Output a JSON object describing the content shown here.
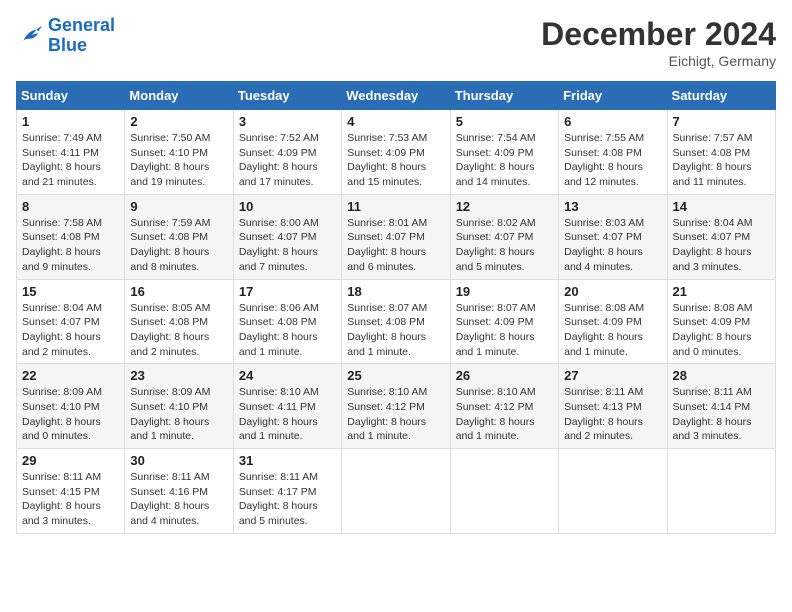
{
  "logo": {
    "text_general": "General",
    "text_blue": "Blue"
  },
  "header": {
    "month_year": "December 2024",
    "location": "Eichigt, Germany"
  },
  "days_of_week": [
    "Sunday",
    "Monday",
    "Tuesday",
    "Wednesday",
    "Thursday",
    "Friday",
    "Saturday"
  ],
  "weeks": [
    [
      {
        "day": "1",
        "info": "Sunrise: 7:49 AM\nSunset: 4:11 PM\nDaylight: 8 hours and 21 minutes."
      },
      {
        "day": "2",
        "info": "Sunrise: 7:50 AM\nSunset: 4:10 PM\nDaylight: 8 hours and 19 minutes."
      },
      {
        "day": "3",
        "info": "Sunrise: 7:52 AM\nSunset: 4:09 PM\nDaylight: 8 hours and 17 minutes."
      },
      {
        "day": "4",
        "info": "Sunrise: 7:53 AM\nSunset: 4:09 PM\nDaylight: 8 hours and 15 minutes."
      },
      {
        "day": "5",
        "info": "Sunrise: 7:54 AM\nSunset: 4:09 PM\nDaylight: 8 hours and 14 minutes."
      },
      {
        "day": "6",
        "info": "Sunrise: 7:55 AM\nSunset: 4:08 PM\nDaylight: 8 hours and 12 minutes."
      },
      {
        "day": "7",
        "info": "Sunrise: 7:57 AM\nSunset: 4:08 PM\nDaylight: 8 hours and 11 minutes."
      }
    ],
    [
      {
        "day": "8",
        "info": "Sunrise: 7:58 AM\nSunset: 4:08 PM\nDaylight: 8 hours and 9 minutes."
      },
      {
        "day": "9",
        "info": "Sunrise: 7:59 AM\nSunset: 4:08 PM\nDaylight: 8 hours and 8 minutes."
      },
      {
        "day": "10",
        "info": "Sunrise: 8:00 AM\nSunset: 4:07 PM\nDaylight: 8 hours and 7 minutes."
      },
      {
        "day": "11",
        "info": "Sunrise: 8:01 AM\nSunset: 4:07 PM\nDaylight: 8 hours and 6 minutes."
      },
      {
        "day": "12",
        "info": "Sunrise: 8:02 AM\nSunset: 4:07 PM\nDaylight: 8 hours and 5 minutes."
      },
      {
        "day": "13",
        "info": "Sunrise: 8:03 AM\nSunset: 4:07 PM\nDaylight: 8 hours and 4 minutes."
      },
      {
        "day": "14",
        "info": "Sunrise: 8:04 AM\nSunset: 4:07 PM\nDaylight: 8 hours and 3 minutes."
      }
    ],
    [
      {
        "day": "15",
        "info": "Sunrise: 8:04 AM\nSunset: 4:07 PM\nDaylight: 8 hours and 2 minutes."
      },
      {
        "day": "16",
        "info": "Sunrise: 8:05 AM\nSunset: 4:08 PM\nDaylight: 8 hours and 2 minutes."
      },
      {
        "day": "17",
        "info": "Sunrise: 8:06 AM\nSunset: 4:08 PM\nDaylight: 8 hours and 1 minute."
      },
      {
        "day": "18",
        "info": "Sunrise: 8:07 AM\nSunset: 4:08 PM\nDaylight: 8 hours and 1 minute."
      },
      {
        "day": "19",
        "info": "Sunrise: 8:07 AM\nSunset: 4:09 PM\nDaylight: 8 hours and 1 minute."
      },
      {
        "day": "20",
        "info": "Sunrise: 8:08 AM\nSunset: 4:09 PM\nDaylight: 8 hours and 1 minute."
      },
      {
        "day": "21",
        "info": "Sunrise: 8:08 AM\nSunset: 4:09 PM\nDaylight: 8 hours and 0 minutes."
      }
    ],
    [
      {
        "day": "22",
        "info": "Sunrise: 8:09 AM\nSunset: 4:10 PM\nDaylight: 8 hours and 0 minutes."
      },
      {
        "day": "23",
        "info": "Sunrise: 8:09 AM\nSunset: 4:10 PM\nDaylight: 8 hours and 1 minute."
      },
      {
        "day": "24",
        "info": "Sunrise: 8:10 AM\nSunset: 4:11 PM\nDaylight: 8 hours and 1 minute."
      },
      {
        "day": "25",
        "info": "Sunrise: 8:10 AM\nSunset: 4:12 PM\nDaylight: 8 hours and 1 minute."
      },
      {
        "day": "26",
        "info": "Sunrise: 8:10 AM\nSunset: 4:12 PM\nDaylight: 8 hours and 1 minute."
      },
      {
        "day": "27",
        "info": "Sunrise: 8:11 AM\nSunset: 4:13 PM\nDaylight: 8 hours and 2 minutes."
      },
      {
        "day": "28",
        "info": "Sunrise: 8:11 AM\nSunset: 4:14 PM\nDaylight: 8 hours and 3 minutes."
      }
    ],
    [
      {
        "day": "29",
        "info": "Sunrise: 8:11 AM\nSunset: 4:15 PM\nDaylight: 8 hours and 3 minutes."
      },
      {
        "day": "30",
        "info": "Sunrise: 8:11 AM\nSunset: 4:16 PM\nDaylight: 8 hours and 4 minutes."
      },
      {
        "day": "31",
        "info": "Sunrise: 8:11 AM\nSunset: 4:17 PM\nDaylight: 8 hours and 5 minutes."
      },
      null,
      null,
      null,
      null
    ]
  ]
}
